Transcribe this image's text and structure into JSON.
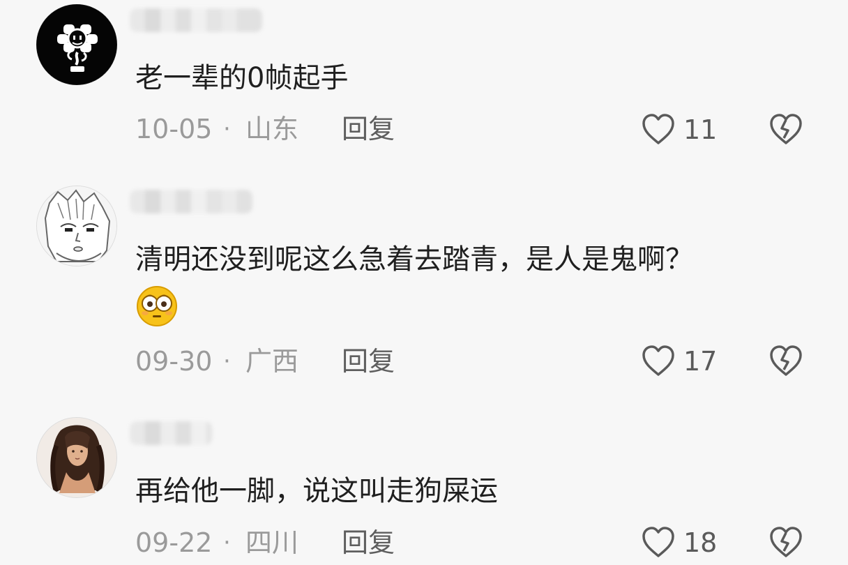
{
  "comments": [
    {
      "text": "老一辈的0帧起手",
      "date": "10-05",
      "separator": "·",
      "location": "山东",
      "reply_label": "回复",
      "like_count": "11",
      "avatar_icon": "flowey-avatar"
    },
    {
      "text": "清明还没到呢这么急着去踏青，是人是鬼啊？",
      "emoji": "flushed-face-emoji",
      "date": "09-30",
      "separator": "·",
      "location": "广西",
      "reply_label": "回复",
      "like_count": "17",
      "avatar_icon": "manga-avatar"
    },
    {
      "text": "再给他一脚，说这叫走狗屎运",
      "date": "09-22",
      "separator": "·",
      "location": "四川",
      "reply_label": "回复",
      "like_count": "18",
      "avatar_icon": "portrait-avatar"
    }
  ],
  "colors": {
    "background": "#f7f7f7",
    "text": "#1f1f1f",
    "meta": "#9a9a9a",
    "icon": "#5a5a5a"
  }
}
